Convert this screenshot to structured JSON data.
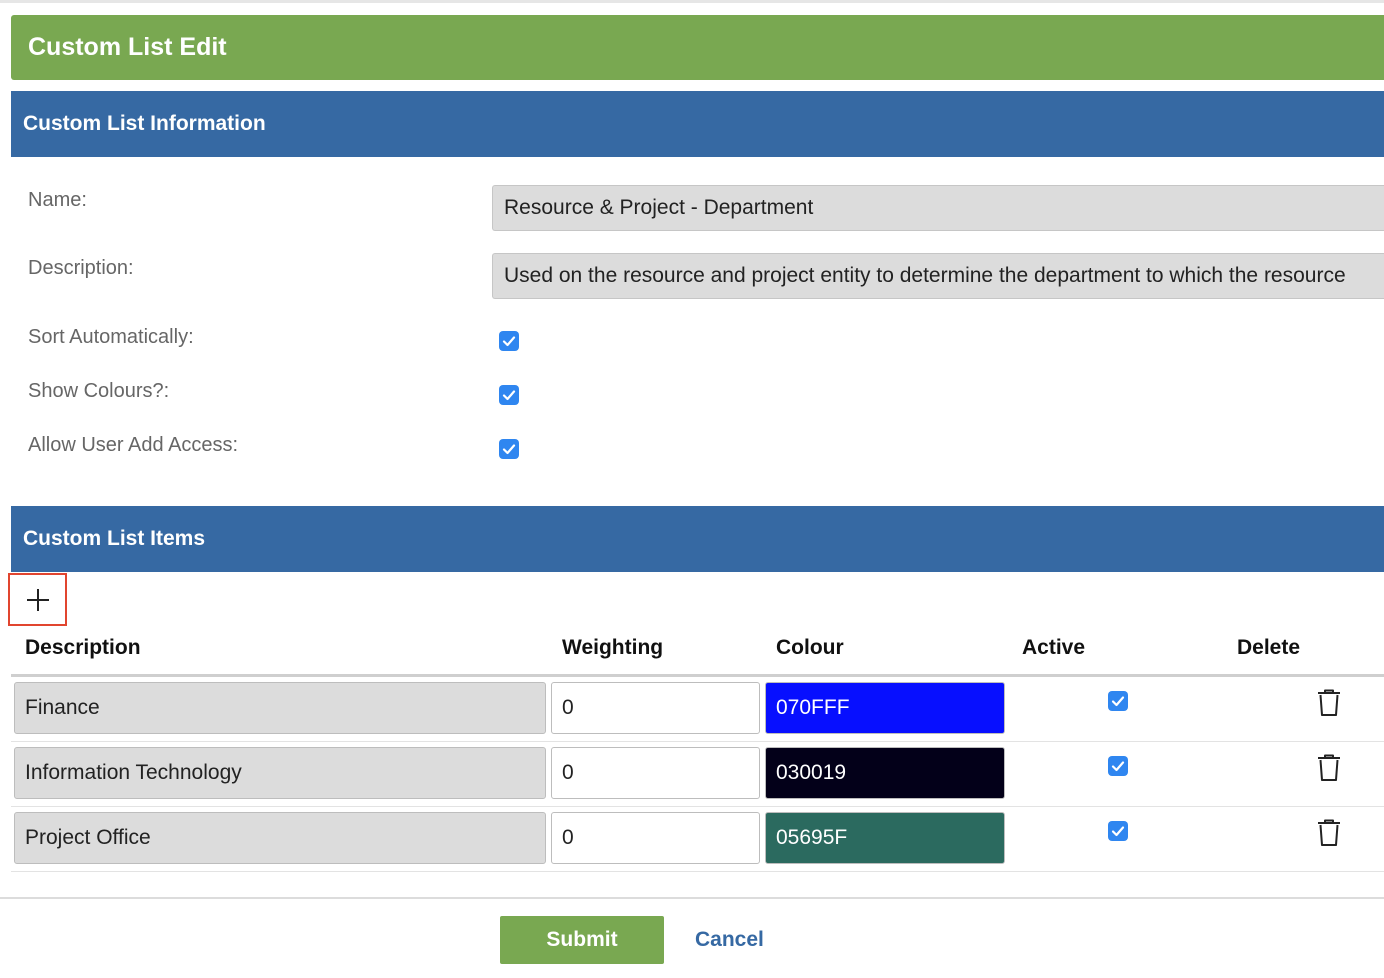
{
  "header": {
    "title": "Custom List  Edit"
  },
  "info": {
    "section_title": "Custom List Information",
    "name_label": "Name:",
    "name_value": "Resource & Project - Department",
    "description_label": "Description:",
    "description_value": "Used on the resource and project entity to determine the department to which the resource",
    "sort_label": "Sort Automatically:",
    "sort_checked": true,
    "colours_label": "Show Colours?:",
    "colours_checked": true,
    "user_add_label": "Allow User Add Access:",
    "user_add_checked": true
  },
  "items": {
    "section_title": "Custom List Items",
    "add_icon": "plus-icon",
    "columns": [
      "Description",
      "Weighting",
      "Colour",
      "Active",
      "Delete"
    ],
    "rows": [
      {
        "description": "Finance",
        "weighting": "0",
        "colour": "070FFF",
        "colour_hex": "#070FFF",
        "active": true
      },
      {
        "description": "Information Technology",
        "weighting": "0",
        "colour": "030019",
        "colour_hex": "#030019",
        "active": true
      },
      {
        "description": "Project Office",
        "weighting": "0",
        "colour": "05695F",
        "colour_hex": "#2B6A5F",
        "active": true
      }
    ]
  },
  "footer": {
    "submit_label": "Submit",
    "cancel_label": "Cancel"
  },
  "colors": {
    "title_bar": "#79a851",
    "section_head": "#3669a3",
    "checkbox": "#2f86f0",
    "add_highlight": "#e1452f"
  }
}
